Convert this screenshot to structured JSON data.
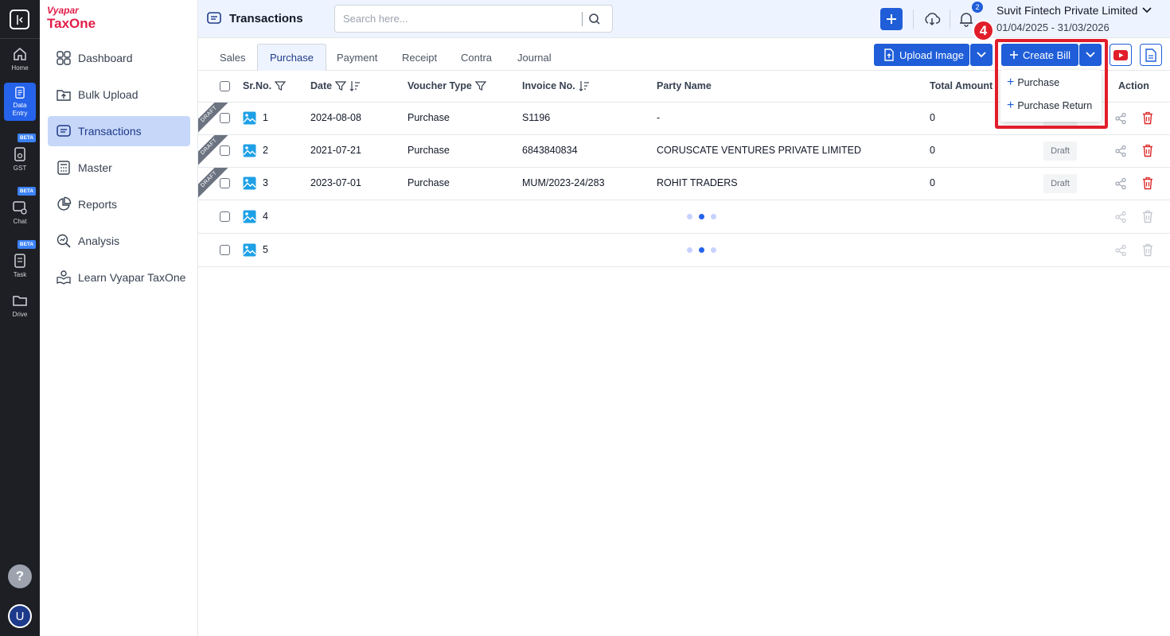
{
  "rail": {
    "items": [
      {
        "label": "Home"
      },
      {
        "label": "Data Entry"
      },
      {
        "label": "GST",
        "badge": "BETA"
      },
      {
        "label": "Chat",
        "badge": "BETA"
      },
      {
        "label": "Task",
        "badge": "BETA"
      },
      {
        "label": "Drive"
      }
    ],
    "help": "?",
    "avatar": "U"
  },
  "brand": {
    "line1": "Vyapar",
    "line2": "TaxOne"
  },
  "sidebar": {
    "items": [
      {
        "label": "Dashboard",
        "icon": "grid-icon"
      },
      {
        "label": "Bulk Upload",
        "icon": "upload-icon"
      },
      {
        "label": "Transactions",
        "icon": "transactions-icon",
        "active": true
      },
      {
        "label": "Master",
        "icon": "calculator-icon"
      },
      {
        "label": "Reports",
        "icon": "pie-chart-icon"
      },
      {
        "label": "Analysis",
        "icon": "analysis-icon"
      },
      {
        "label": "Learn Vyapar TaxOne",
        "icon": "learn-icon"
      }
    ]
  },
  "header": {
    "title": "Transactions",
    "search_placeholder": "Search here...",
    "notification_count": "2",
    "company": "Suvit Fintech Private Limited",
    "financial_year": "01/04/2025 - 31/03/2026"
  },
  "tabs": [
    {
      "label": "Sales"
    },
    {
      "label": "Purchase",
      "active": true
    },
    {
      "label": "Payment"
    },
    {
      "label": "Receipt"
    },
    {
      "label": "Contra"
    },
    {
      "label": "Journal"
    }
  ],
  "actions": {
    "upload_image": "Upload Image",
    "create_bill": "Create Bill"
  },
  "dropdown": {
    "items": [
      {
        "label": "Purchase"
      },
      {
        "label": "Purchase Return"
      }
    ]
  },
  "annotation": {
    "number": "4"
  },
  "table": {
    "columns": {
      "sr_no": "Sr.No.",
      "date": "Date",
      "voucher_type": "Voucher Type",
      "invoice_no": "Invoice No.",
      "party_name": "Party Name",
      "total_amount": "Total Amount",
      "action": "Action"
    },
    "rows": [
      {
        "sr": "1",
        "date": "2024-08-08",
        "voucher": "Purchase",
        "invoice": "S1196",
        "party": "-",
        "amount": "0",
        "status": "Draft",
        "ribbon": "DRAFT"
      },
      {
        "sr": "2",
        "date": "2021-07-21",
        "voucher": "Purchase",
        "invoice": "6843840834",
        "party": "CORUSCATE VENTURES PRIVATE LIMITED",
        "amount": "0",
        "status": "Draft",
        "ribbon": "DRAFT"
      },
      {
        "sr": "3",
        "date": "2023-07-01",
        "voucher": "Purchase",
        "invoice": "MUM/2023-24/283",
        "party": "ROHIT TRADERS",
        "amount": "0",
        "status": "Draft",
        "ribbon": "DRAFT"
      },
      {
        "sr": "4",
        "loading": true
      },
      {
        "sr": "5",
        "loading": true
      }
    ]
  },
  "colors": {
    "primary": "#1f5ed8",
    "brand": "#e11d48",
    "annotation": "#e11d2a",
    "delete": "#dc2626"
  }
}
